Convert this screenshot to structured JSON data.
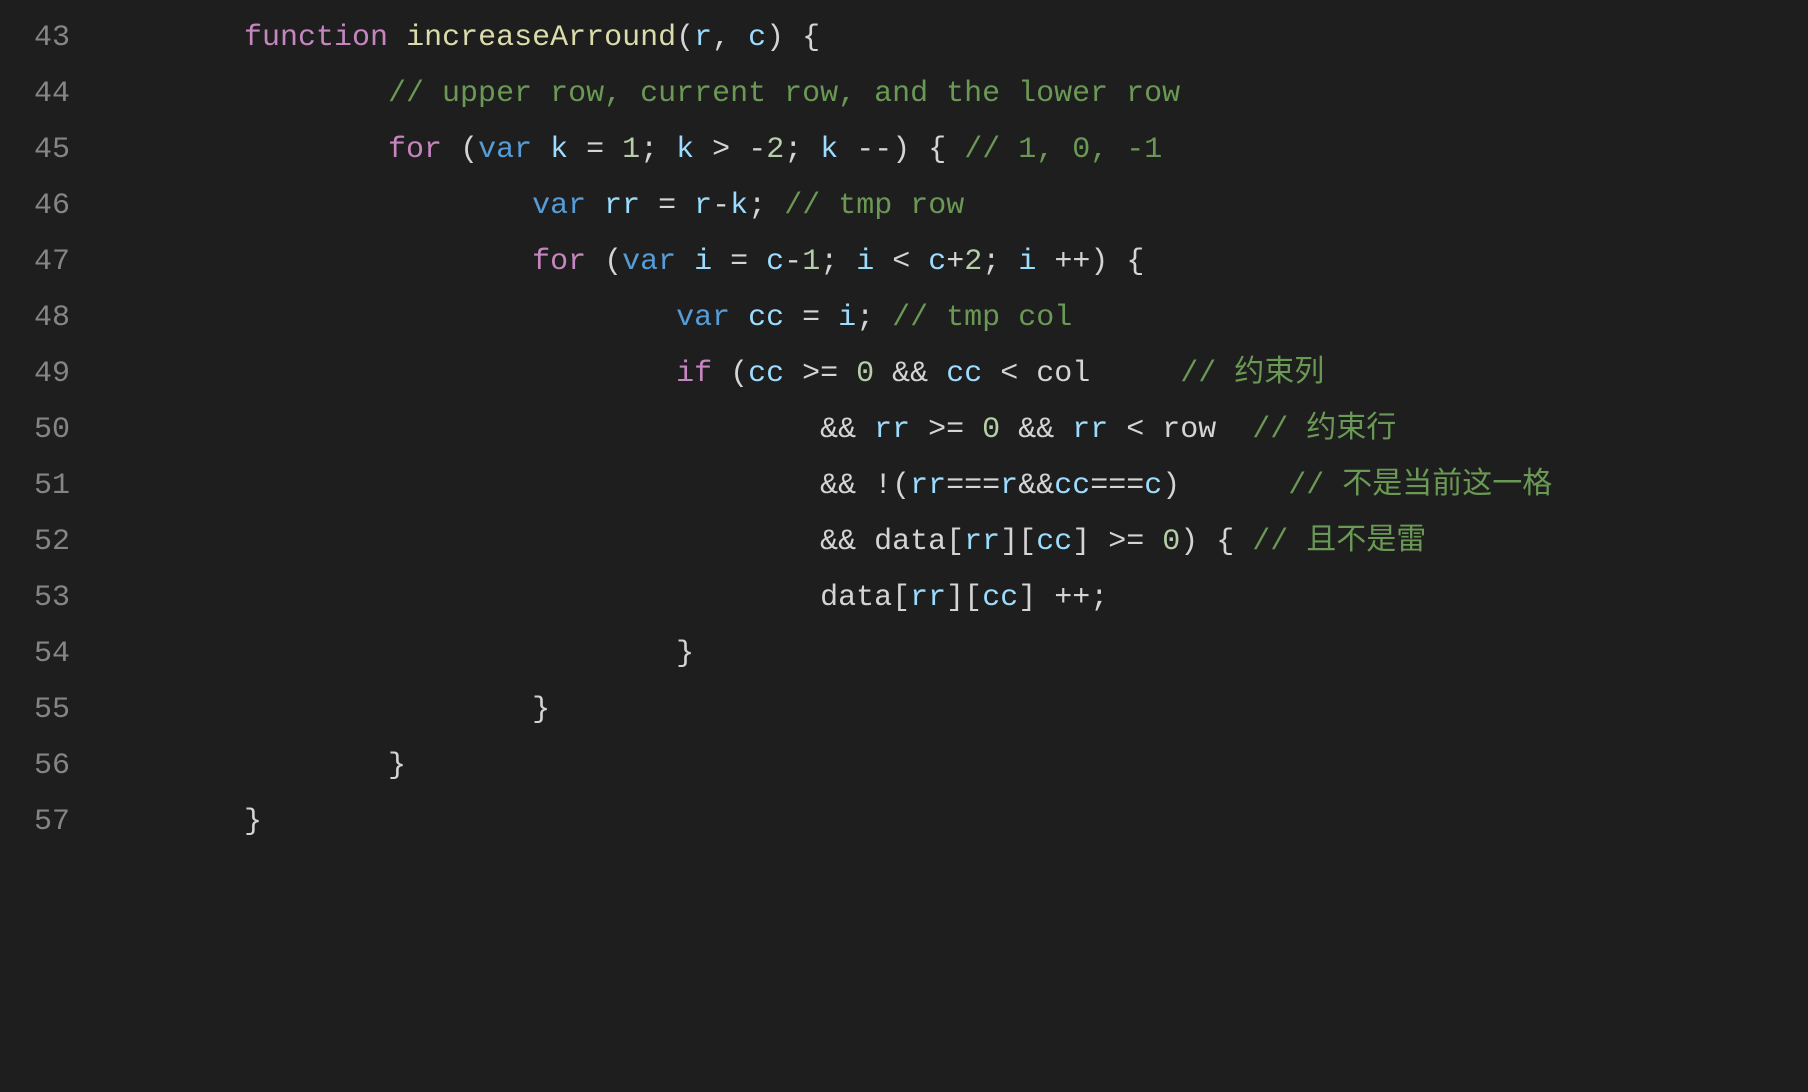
{
  "editor": {
    "language": "javascript",
    "theme": "dark-plus",
    "first_line_number": 43,
    "lines": [
      {
        "n": 43,
        "indent": 8,
        "tokens": [
          {
            "t": "function ",
            "c": "keyword"
          },
          {
            "t": "increaseArround",
            "c": "func"
          },
          {
            "t": "(",
            "c": "punct"
          },
          {
            "t": "r",
            "c": "param"
          },
          {
            "t": ", ",
            "c": "punct"
          },
          {
            "t": "c",
            "c": "param"
          },
          {
            "t": ") {",
            "c": "punct"
          }
        ]
      },
      {
        "n": 44,
        "indent": 16,
        "tokens": [
          {
            "t": "// upper row, current row, and the lower row",
            "c": "comment"
          }
        ]
      },
      {
        "n": 45,
        "indent": 16,
        "tokens": [
          {
            "t": "for ",
            "c": "keyword"
          },
          {
            "t": "(",
            "c": "punct"
          },
          {
            "t": "var ",
            "c": "storage"
          },
          {
            "t": "k",
            "c": "param"
          },
          {
            "t": " = ",
            "c": "op"
          },
          {
            "t": "1",
            "c": "num"
          },
          {
            "t": "; ",
            "c": "punct"
          },
          {
            "t": "k",
            "c": "param"
          },
          {
            "t": " > ",
            "c": "op"
          },
          {
            "t": "-",
            "c": "op"
          },
          {
            "t": "2",
            "c": "num"
          },
          {
            "t": "; ",
            "c": "punct"
          },
          {
            "t": "k",
            "c": "param"
          },
          {
            "t": " --) { ",
            "c": "punct"
          },
          {
            "t": "// 1, 0, -1",
            "c": "comment"
          }
        ]
      },
      {
        "n": 46,
        "indent": 24,
        "tokens": [
          {
            "t": "var ",
            "c": "storage"
          },
          {
            "t": "rr",
            "c": "param"
          },
          {
            "t": " = ",
            "c": "op"
          },
          {
            "t": "r",
            "c": "param"
          },
          {
            "t": "-",
            "c": "op"
          },
          {
            "t": "k",
            "c": "param"
          },
          {
            "t": "; ",
            "c": "punct"
          },
          {
            "t": "// tmp row",
            "c": "comment"
          }
        ]
      },
      {
        "n": 47,
        "indent": 24,
        "tokens": [
          {
            "t": "for ",
            "c": "keyword"
          },
          {
            "t": "(",
            "c": "punct"
          },
          {
            "t": "var ",
            "c": "storage"
          },
          {
            "t": "i",
            "c": "param"
          },
          {
            "t": " = ",
            "c": "op"
          },
          {
            "t": "c",
            "c": "param"
          },
          {
            "t": "-",
            "c": "op"
          },
          {
            "t": "1",
            "c": "num"
          },
          {
            "t": "; ",
            "c": "punct"
          },
          {
            "t": "i",
            "c": "param"
          },
          {
            "t": " < ",
            "c": "op"
          },
          {
            "t": "c",
            "c": "param"
          },
          {
            "t": "+",
            "c": "op"
          },
          {
            "t": "2",
            "c": "num"
          },
          {
            "t": "; ",
            "c": "punct"
          },
          {
            "t": "i",
            "c": "param"
          },
          {
            "t": " ++) {",
            "c": "punct"
          }
        ]
      },
      {
        "n": 48,
        "indent": 32,
        "tokens": [
          {
            "t": "var ",
            "c": "storage"
          },
          {
            "t": "cc",
            "c": "param"
          },
          {
            "t": " = ",
            "c": "op"
          },
          {
            "t": "i",
            "c": "param"
          },
          {
            "t": "; ",
            "c": "punct"
          },
          {
            "t": "// tmp col",
            "c": "comment"
          }
        ]
      },
      {
        "n": 49,
        "indent": 32,
        "tokens": [
          {
            "t": "if ",
            "c": "keyword"
          },
          {
            "t": "(",
            "c": "punct"
          },
          {
            "t": "cc",
            "c": "param"
          },
          {
            "t": " >= ",
            "c": "op"
          },
          {
            "t": "0",
            "c": "num"
          },
          {
            "t": " && ",
            "c": "op"
          },
          {
            "t": "cc",
            "c": "param"
          },
          {
            "t": " < ",
            "c": "op"
          },
          {
            "t": "col",
            "c": "ident"
          },
          {
            "t": "     ",
            "c": "punct"
          },
          {
            "t": "// 约束列",
            "c": "comment"
          }
        ]
      },
      {
        "n": 50,
        "indent": 40,
        "tokens": [
          {
            "t": "&& ",
            "c": "op"
          },
          {
            "t": "rr",
            "c": "param"
          },
          {
            "t": " >= ",
            "c": "op"
          },
          {
            "t": "0",
            "c": "num"
          },
          {
            "t": " && ",
            "c": "op"
          },
          {
            "t": "rr",
            "c": "param"
          },
          {
            "t": " < ",
            "c": "op"
          },
          {
            "t": "row",
            "c": "ident"
          },
          {
            "t": "  ",
            "c": "punct"
          },
          {
            "t": "// 约束行",
            "c": "comment"
          }
        ]
      },
      {
        "n": 51,
        "indent": 40,
        "tokens": [
          {
            "t": "&& !(",
            "c": "op"
          },
          {
            "t": "rr",
            "c": "param"
          },
          {
            "t": "===",
            "c": "op"
          },
          {
            "t": "r",
            "c": "param"
          },
          {
            "t": "&&",
            "c": "op"
          },
          {
            "t": "cc",
            "c": "param"
          },
          {
            "t": "===",
            "c": "op"
          },
          {
            "t": "c",
            "c": "param"
          },
          {
            "t": ")      ",
            "c": "punct"
          },
          {
            "t": "// 不是当前这一格",
            "c": "comment"
          }
        ]
      },
      {
        "n": 52,
        "indent": 40,
        "tokens": [
          {
            "t": "&& ",
            "c": "op"
          },
          {
            "t": "data",
            "c": "ident"
          },
          {
            "t": "[",
            "c": "punct"
          },
          {
            "t": "rr",
            "c": "param"
          },
          {
            "t": "][",
            "c": "punct"
          },
          {
            "t": "cc",
            "c": "param"
          },
          {
            "t": "] >= ",
            "c": "op"
          },
          {
            "t": "0",
            "c": "num"
          },
          {
            "t": ") { ",
            "c": "punct"
          },
          {
            "t": "// 且不是雷",
            "c": "comment"
          }
        ]
      },
      {
        "n": 53,
        "indent": 40,
        "tokens": [
          {
            "t": "data",
            "c": "ident"
          },
          {
            "t": "[",
            "c": "punct"
          },
          {
            "t": "rr",
            "c": "param"
          },
          {
            "t": "][",
            "c": "punct"
          },
          {
            "t": "cc",
            "c": "param"
          },
          {
            "t": "] ++;",
            "c": "punct"
          }
        ]
      },
      {
        "n": 54,
        "indent": 32,
        "tokens": [
          {
            "t": "}",
            "c": "punct"
          }
        ]
      },
      {
        "n": 55,
        "indent": 24,
        "tokens": [
          {
            "t": "}",
            "c": "punct"
          }
        ]
      },
      {
        "n": 56,
        "indent": 16,
        "tokens": [
          {
            "t": "}",
            "c": "punct"
          }
        ]
      },
      {
        "n": 57,
        "indent": 8,
        "tokens": [
          {
            "t": "}",
            "c": "punct"
          }
        ]
      }
    ]
  }
}
